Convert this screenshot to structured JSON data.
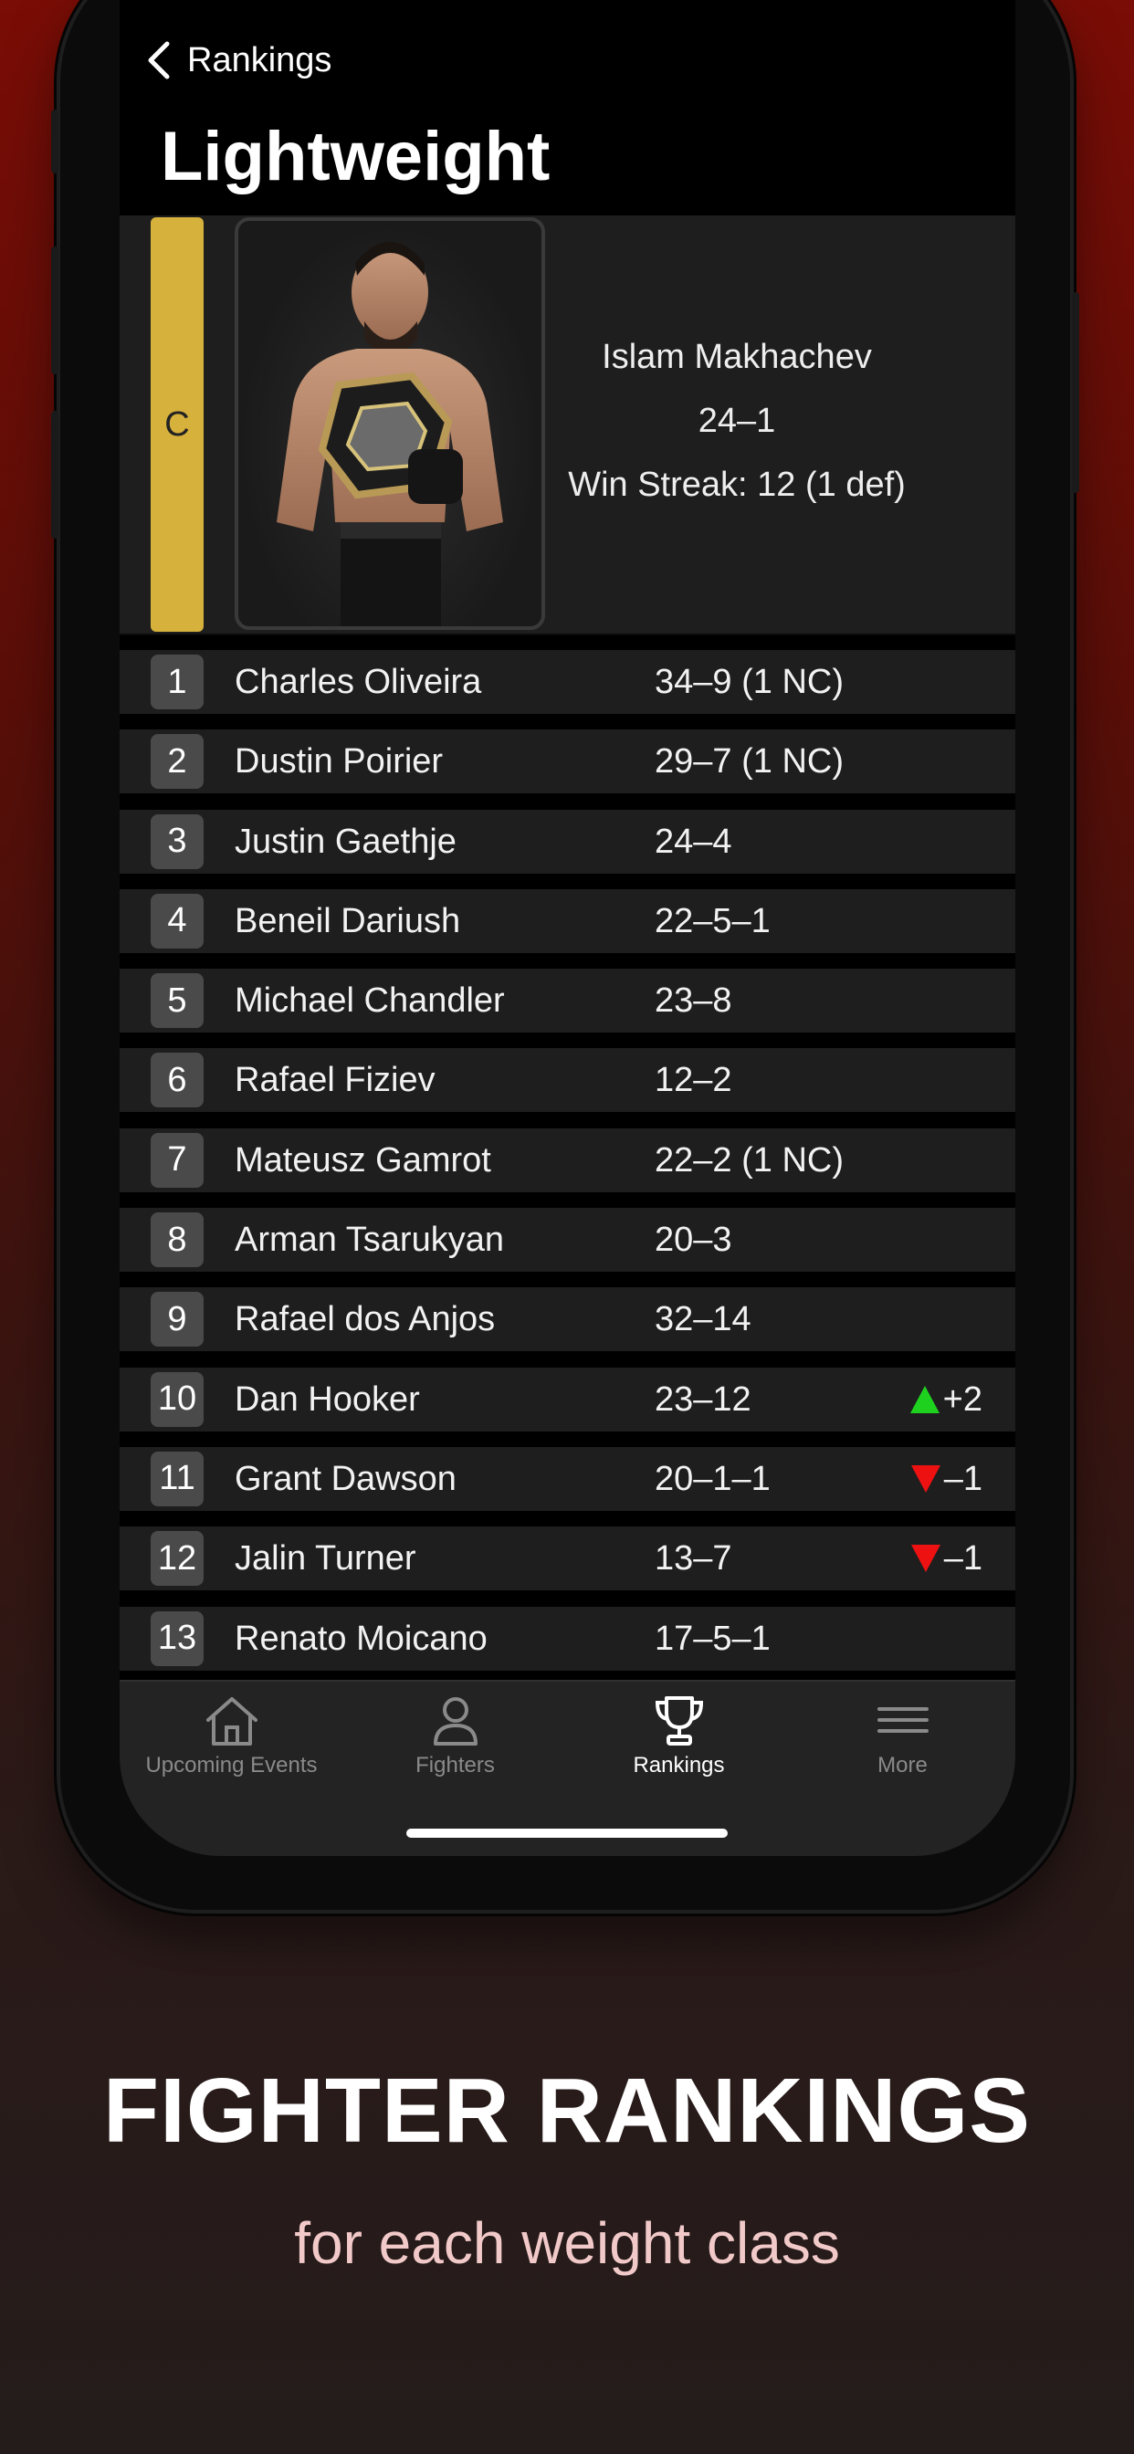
{
  "nav": {
    "back_label": "Rankings"
  },
  "page_title": "Lightweight",
  "champion": {
    "badge": "C",
    "name": "Islam Makhachev",
    "record": "24–1",
    "streak": "Win Streak: 12 (1 def)"
  },
  "rankings": [
    {
      "rank": "1",
      "name": "Charles Oliveira",
      "record": "34–9 (1 NC)",
      "move": "",
      "dir": ""
    },
    {
      "rank": "2",
      "name": "Dustin Poirier",
      "record": "29–7 (1 NC)",
      "move": "",
      "dir": ""
    },
    {
      "rank": "3",
      "name": "Justin Gaethje",
      "record": "24–4",
      "move": "",
      "dir": ""
    },
    {
      "rank": "4",
      "name": "Beneil Dariush",
      "record": "22–5–1",
      "move": "",
      "dir": ""
    },
    {
      "rank": "5",
      "name": "Michael Chandler",
      "record": "23–8",
      "move": "",
      "dir": ""
    },
    {
      "rank": "6",
      "name": "Rafael Fiziev",
      "record": "12–2",
      "move": "",
      "dir": ""
    },
    {
      "rank": "7",
      "name": "Mateusz Gamrot",
      "record": "22–2 (1 NC)",
      "move": "",
      "dir": ""
    },
    {
      "rank": "8",
      "name": "Arman Tsarukyan",
      "record": "20–3",
      "move": "",
      "dir": ""
    },
    {
      "rank": "9",
      "name": "Rafael dos Anjos",
      "record": "32–14",
      "move": "",
      "dir": ""
    },
    {
      "rank": "10",
      "name": "Dan Hooker",
      "record": "23–12",
      "move": "+2",
      "dir": "up"
    },
    {
      "rank": "11",
      "name": "Grant Dawson",
      "record": "20–1–1",
      "move": "–1",
      "dir": "down"
    },
    {
      "rank": "12",
      "name": "Jalin Turner",
      "record": "13–7",
      "move": "–1",
      "dir": "down"
    },
    {
      "rank": "13",
      "name": "Renato Moicano",
      "record": "17–5–1",
      "move": "",
      "dir": ""
    }
  ],
  "tabs": [
    {
      "label": "Upcoming Events",
      "icon": "house-icon"
    },
    {
      "label": "Fighters",
      "icon": "person-icon"
    },
    {
      "label": "Rankings",
      "icon": "trophy-icon",
      "active": true
    },
    {
      "label": "More",
      "icon": "menu-icon"
    }
  ],
  "promo": {
    "headline": "FIGHTER RANKINGS",
    "subheadline": "for each weight class"
  },
  "colors": {
    "champion_badge": "#d6b13c",
    "up_arrow": "#1fd11f",
    "down_arrow": "#ee1111",
    "background_top": "#7a0d06",
    "background_bottom": "#241c1b"
  }
}
